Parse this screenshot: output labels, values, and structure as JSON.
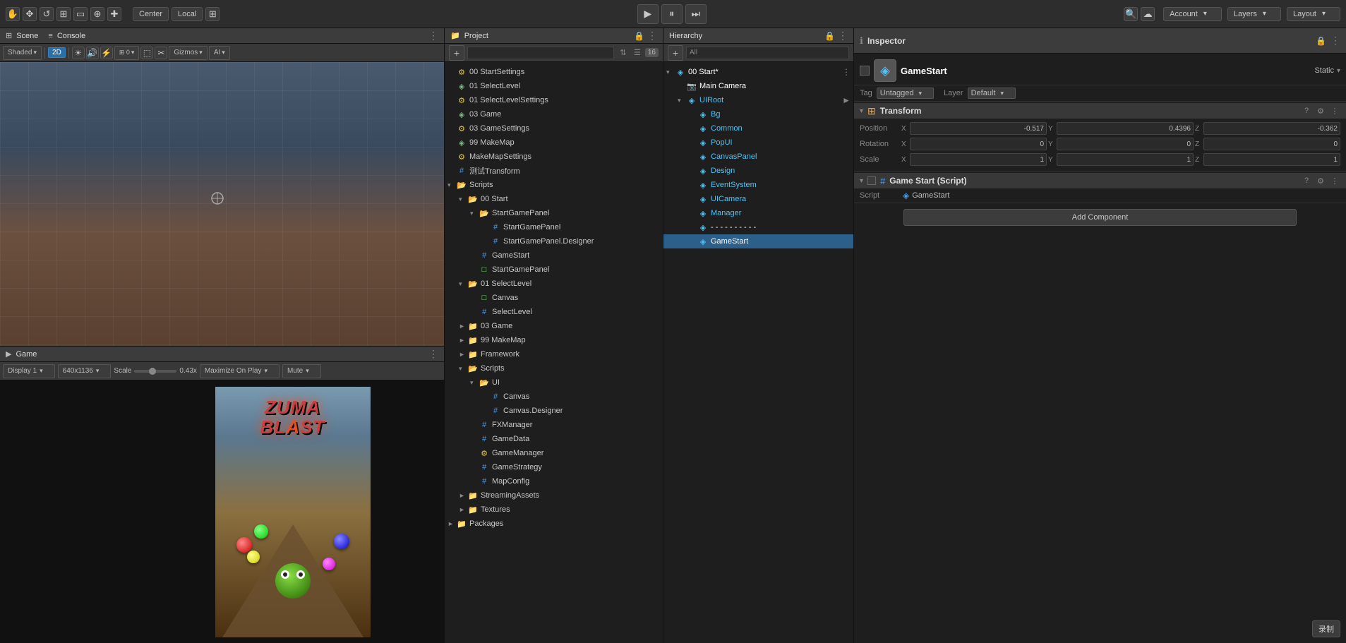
{
  "toolbar": {
    "hand_tool": "✋",
    "move_tool": "✥",
    "rotate_tool": "↺",
    "scale_tool": "⊞",
    "rect_tool": "▭",
    "transform_tool": "⊕",
    "extra_tool": "✚",
    "center_label": "Center",
    "local_label": "Local",
    "grid_btn": "⊞",
    "play_btn": "▶",
    "pause_btn": "⏸",
    "step_btn": "⏭",
    "search_icon": "🔍",
    "cloud_icon": "☁",
    "account_label": "Account",
    "account_arrow": "▾",
    "layers_label": "Layers",
    "layers_arrow": "▾",
    "layout_label": "Layout",
    "layout_arrow": "▾"
  },
  "scene_panel": {
    "tab_label": "Scene",
    "tab_icon": "⊞",
    "console_tab": "Console",
    "console_icon": "≡",
    "shaded_label": "Shaded",
    "mode_2d": "2D",
    "gizmos_label": "Gizmos",
    "ai_label": "AI",
    "more_icon": "⋮"
  },
  "game_panel": {
    "tab_label": "Game",
    "tab_icon": "▶",
    "display_label": "Display 1",
    "resolution_label": "640x1136",
    "scale_label": "Scale",
    "scale_value": "0.43x",
    "maximize_label": "Maximize On Play",
    "mute_label": "Mute",
    "more_icon": "⋮"
  },
  "project_panel": {
    "title": "Project",
    "lock_icon": "🔒",
    "more_icon": "⋮",
    "add_icon": "+",
    "search_placeholder": "",
    "count_badge": "16",
    "items": [
      {
        "indent": 0,
        "label": "00 StartSettings",
        "icon": "⚙",
        "type": "settings",
        "arrow": ""
      },
      {
        "indent": 0,
        "label": "01 SelectLevel",
        "icon": "◈",
        "type": "scene",
        "arrow": ""
      },
      {
        "indent": 0,
        "label": "01 SelectLevelSettings",
        "icon": "⚙",
        "type": "settings",
        "arrow": ""
      },
      {
        "indent": 0,
        "label": "03 Game",
        "icon": "◈",
        "type": "scene",
        "arrow": ""
      },
      {
        "indent": 0,
        "label": "03 GameSettings",
        "icon": "⚙",
        "type": "settings",
        "arrow": ""
      },
      {
        "indent": 0,
        "label": "99 MakeMap",
        "icon": "◈",
        "type": "scene",
        "arrow": ""
      },
      {
        "indent": 0,
        "label": "MakeMapSettings",
        "icon": "⚙",
        "type": "settings",
        "arrow": ""
      },
      {
        "indent": 0,
        "label": "测试Transform",
        "icon": "#",
        "type": "script",
        "arrow": ""
      },
      {
        "indent": 0,
        "label": "Scripts",
        "icon": "📁",
        "type": "folder",
        "arrow": "▾",
        "expanded": true
      },
      {
        "indent": 1,
        "label": "00 Start",
        "icon": "📁",
        "type": "folder",
        "arrow": "▾",
        "expanded": true
      },
      {
        "indent": 2,
        "label": "StartGamePanel",
        "icon": "📁",
        "type": "folder",
        "arrow": "▾",
        "expanded": true
      },
      {
        "indent": 3,
        "label": "StartGamePanel",
        "icon": "#",
        "type": "script",
        "arrow": ""
      },
      {
        "indent": 3,
        "label": "StartGamePanel.Designer",
        "icon": "#",
        "type": "script",
        "arrow": ""
      },
      {
        "indent": 2,
        "label": "GameStart",
        "icon": "#",
        "type": "script",
        "arrow": ""
      },
      {
        "indent": 2,
        "label": "StartGamePanel",
        "icon": "□",
        "type": "prefab",
        "arrow": ""
      },
      {
        "indent": 1,
        "label": "01 SelectLevel",
        "icon": "📁",
        "type": "folder",
        "arrow": "▾",
        "expanded": true
      },
      {
        "indent": 2,
        "label": "Canvas",
        "icon": "□",
        "type": "prefab",
        "arrow": ""
      },
      {
        "indent": 2,
        "label": "SelectLevel",
        "icon": "#",
        "type": "script",
        "arrow": ""
      },
      {
        "indent": 1,
        "label": "03 Game",
        "icon": "📁",
        "type": "folder",
        "arrow": "►",
        "expanded": false
      },
      {
        "indent": 1,
        "label": "99 MakeMap",
        "icon": "📁",
        "type": "folder",
        "arrow": "►",
        "expanded": false
      },
      {
        "indent": 1,
        "label": "Framework",
        "icon": "📁",
        "type": "folder",
        "arrow": "►",
        "expanded": false
      },
      {
        "indent": 1,
        "label": "Scripts",
        "icon": "📁",
        "type": "folder",
        "arrow": "▾",
        "expanded": true
      },
      {
        "indent": 2,
        "label": "UI",
        "icon": "📁",
        "type": "folder",
        "arrow": "▾",
        "expanded": true
      },
      {
        "indent": 3,
        "label": "Canvas",
        "icon": "#",
        "type": "script",
        "arrow": ""
      },
      {
        "indent": 3,
        "label": "Canvas.Designer",
        "icon": "#",
        "type": "script",
        "arrow": ""
      },
      {
        "indent": 2,
        "label": "FXManager",
        "icon": "#",
        "type": "script",
        "arrow": ""
      },
      {
        "indent": 2,
        "label": "GameData",
        "icon": "#",
        "type": "script",
        "arrow": ""
      },
      {
        "indent": 2,
        "label": "GameManager",
        "icon": "⚙",
        "type": "settings",
        "arrow": ""
      },
      {
        "indent": 2,
        "label": "GameStrategy",
        "icon": "#",
        "type": "script",
        "arrow": ""
      },
      {
        "indent": 2,
        "label": "MapConfig",
        "icon": "#",
        "type": "script",
        "arrow": ""
      },
      {
        "indent": 1,
        "label": "StreamingAssets",
        "icon": "📁",
        "type": "folder",
        "arrow": "►",
        "expanded": false
      },
      {
        "indent": 1,
        "label": "Textures",
        "icon": "📁",
        "type": "folder",
        "arrow": "►",
        "expanded": false
      },
      {
        "indent": 0,
        "label": "Packages",
        "icon": "📁",
        "type": "folder",
        "arrow": "►",
        "expanded": false
      }
    ]
  },
  "hierarchy_panel": {
    "title": "Hierarchy",
    "lock_icon": "🔒",
    "more_icon": "⋮",
    "add_icon": "+",
    "search_label": "All",
    "items": [
      {
        "indent": 0,
        "label": "00 Start*",
        "color": "modified",
        "arrow": "▾",
        "icon": "⊞",
        "type": "scene",
        "more": "⋮"
      },
      {
        "indent": 1,
        "label": "Main Camera",
        "color": "white",
        "arrow": "",
        "icon": "📷",
        "type": "camera"
      },
      {
        "indent": 1,
        "label": "UIRoot",
        "color": "cyan",
        "arrow": "▾",
        "icon": "◈",
        "type": "uiroot",
        "more": "►"
      },
      {
        "indent": 2,
        "label": "Bg",
        "color": "cyan",
        "arrow": "",
        "icon": "◈",
        "type": "obj"
      },
      {
        "indent": 2,
        "label": "Common",
        "color": "cyan",
        "arrow": "",
        "icon": "◈",
        "type": "obj"
      },
      {
        "indent": 2,
        "label": "PopUI",
        "color": "cyan",
        "arrow": "",
        "icon": "◈",
        "type": "obj"
      },
      {
        "indent": 2,
        "label": "CanvasPanel",
        "color": "cyan",
        "arrow": "",
        "icon": "◈",
        "type": "obj"
      },
      {
        "indent": 2,
        "label": "Design",
        "color": "cyan",
        "arrow": "",
        "icon": "◈",
        "type": "obj"
      },
      {
        "indent": 2,
        "label": "EventSystem",
        "color": "cyan",
        "arrow": "",
        "icon": "◈",
        "type": "obj"
      },
      {
        "indent": 2,
        "label": "UICamera",
        "color": "cyan",
        "arrow": "",
        "icon": "◈",
        "type": "obj"
      },
      {
        "indent": 2,
        "label": "Manager",
        "color": "cyan",
        "arrow": "",
        "icon": "◈",
        "type": "obj"
      },
      {
        "indent": 2,
        "label": "- - - - - - - - - -",
        "color": "white",
        "arrow": "",
        "icon": "◈",
        "type": "separator"
      },
      {
        "indent": 2,
        "label": "GameStart",
        "color": "white",
        "arrow": "",
        "icon": "◈",
        "type": "obj",
        "selected": true
      }
    ]
  },
  "inspector_panel": {
    "title": "Inspector",
    "lock_icon": "🔒",
    "more_icon": "⋮",
    "gameobject": {
      "name": "GameStart",
      "icon": "◈",
      "tag_label": "Tag",
      "tag_value": "Untagged",
      "layer_label": "Layer",
      "layer_value": "Default",
      "static_label": "Static",
      "static_arrow": "▾"
    },
    "transform": {
      "title": "Transform",
      "icon": "⊞",
      "help_icon": "?",
      "settings_icon": "⚙",
      "more_icon": "⋮",
      "position_label": "Position",
      "pos_x_label": "X",
      "pos_x_value": "-0.517",
      "pos_y_label": "Y",
      "pos_y_value": "0.4396",
      "pos_z_label": "Z",
      "pos_z_value": "-0.362",
      "rotation_label": "Rotation",
      "rot_x_label": "X",
      "rot_x_value": "0",
      "rot_y_label": "Y",
      "rot_y_value": "0",
      "rot_z_label": "Z",
      "rot_z_value": "0",
      "scale_label": "Scale",
      "scale_x_label": "X",
      "scale_x_value": "1",
      "scale_y_label": "Y",
      "scale_y_value": "1",
      "scale_z_label": "Z",
      "scale_z_value": "1"
    },
    "game_start_script": {
      "title": "Game Start (Script)",
      "icon": "#",
      "help_icon": "?",
      "settings_icon": "⚙",
      "more_icon": "⋮",
      "script_label": "Script",
      "script_value": "GameStart",
      "script_icon": "◈"
    },
    "add_component_label": "Add Component"
  }
}
